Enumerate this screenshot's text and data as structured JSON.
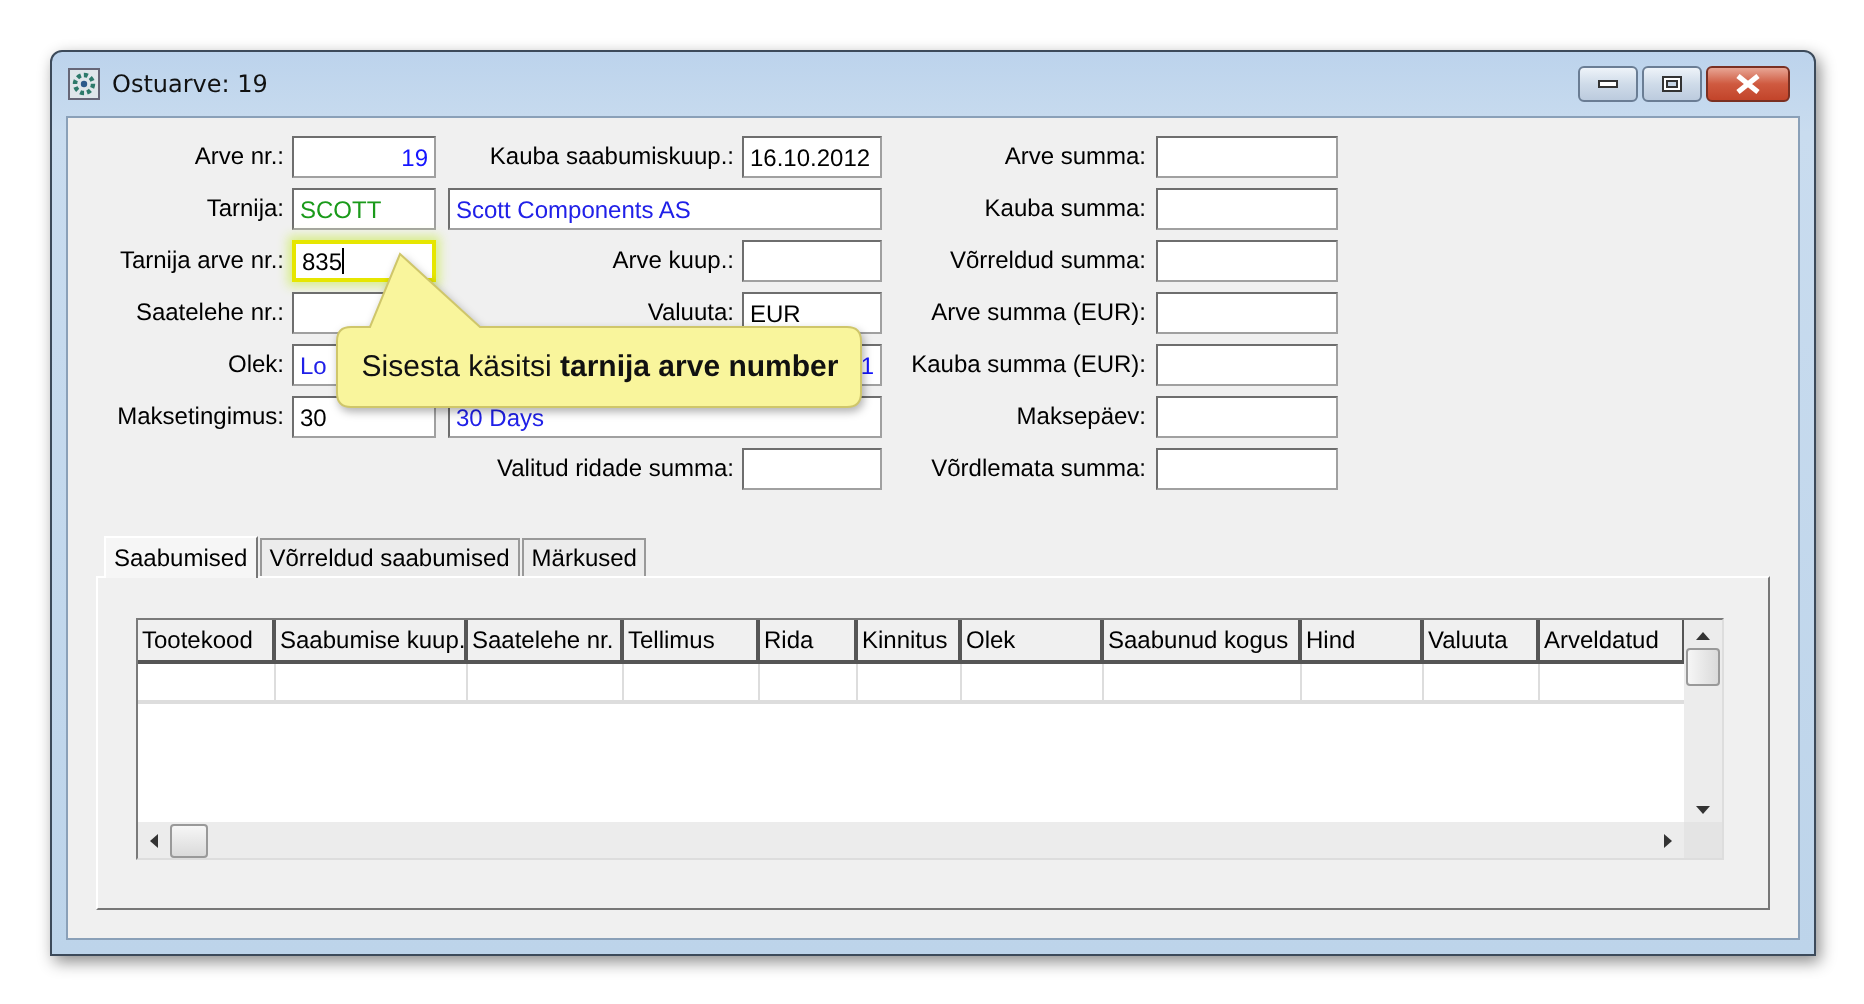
{
  "window": {
    "title": "Ostuarve: 19"
  },
  "form": {
    "rows": [
      {
        "left": {
          "label": "Arve nr.:",
          "field": {
            "kind": "id",
            "value": "19"
          }
        },
        "middle": {
          "kind": "labeled",
          "label": "Kauba saabumiskuup.:",
          "field": {
            "kind": "text",
            "value": "16.10.2012"
          }
        },
        "right": {
          "label": "Arve summa:"
        }
      },
      {
        "left": {
          "label": "Tarnija:",
          "field": {
            "kind": "code",
            "value": "SCOTT"
          }
        },
        "middle": {
          "kind": "wide",
          "field": {
            "kind": "name",
            "value": "Scott Components AS"
          }
        },
        "right": {
          "label": "Kauba summa:"
        }
      },
      {
        "left": {
          "label": "Tarnija arve nr.:",
          "field": {
            "kind": "text",
            "value": "835",
            "highlighted": true
          }
        },
        "middle": {
          "kind": "labeled",
          "label": "Arve kuup.:"
        },
        "right": {
          "label": "Võrreldud summa:"
        }
      },
      {
        "left": {
          "label": "Saatelehe nr.:"
        },
        "middle": {
          "kind": "labeled",
          "label": "Valuuta:",
          "field": {
            "kind": "text",
            "value": "EUR"
          }
        },
        "right": {
          "label": "Arve summa (EUR):"
        }
      },
      {
        "left": {
          "label": "Olek:",
          "field": {
            "kind": "name",
            "value": "Lo"
          }
        },
        "middle": {
          "kind": "wide",
          "field": {
            "kind": "id",
            "value": "1"
          }
        },
        "right": {
          "label": "Kauba summa (EUR):"
        }
      },
      {
        "left": {
          "label": "Maksetingimus:",
          "field": {
            "kind": "text",
            "value": "30"
          }
        },
        "middle": {
          "kind": "wide",
          "field": {
            "kind": "name",
            "value": "30 Days"
          }
        },
        "right": {
          "label": "Maksepäev:"
        }
      },
      {
        "middle": {
          "kind": "labeled",
          "label": "Valitud ridade summa:"
        },
        "right": {
          "label": "Võrdlemata summa:"
        }
      }
    ]
  },
  "callout": {
    "text": "Sisesta käsitsi **tarnija arve number**"
  },
  "tabs": [
    {
      "label": "Saabumised",
      "selected": true
    },
    {
      "label": "Võrreldud saabumised",
      "selected": false
    },
    {
      "label": "Märkused",
      "selected": false
    }
  ],
  "table": {
    "columns": [
      "Tootekood",
      "Saabumise kuup.",
      "Saatelehe nr.",
      "Tellimus",
      "Rida",
      "Kinnitus",
      "Olek",
      "Saabunud kogus",
      "Hind",
      "Valuuta",
      "Arveldatud"
    ]
  }
}
